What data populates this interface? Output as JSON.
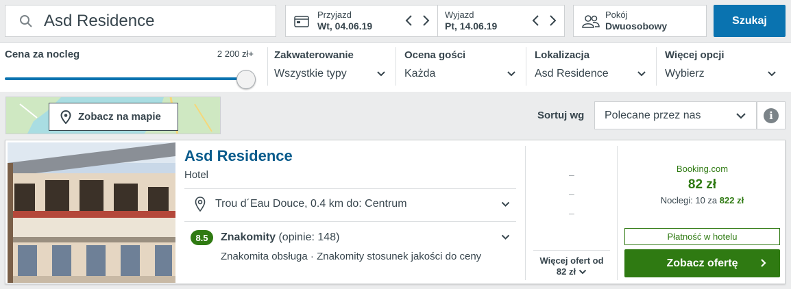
{
  "search": {
    "value": "Asd Residence",
    "icon": "search-icon"
  },
  "dates": {
    "checkin_label": "Przyjazd",
    "checkin_value": "Wt, 04.06.19",
    "checkout_label": "Wyjazd",
    "checkout_value": "Pt, 14.06.19"
  },
  "room": {
    "label": "Pokój",
    "value": "Dwuosobowy"
  },
  "search_button": "Szukaj",
  "filters": {
    "price_label": "Cena za nocleg",
    "price_max": "2 200 zł+",
    "price_slider_fraction": 1.0,
    "accommodation_label": "Zakwaterowanie",
    "accommodation_value": "Wszystkie typy",
    "rating_label": "Ocena gości",
    "rating_value": "Każda",
    "location_label": "Lokalizacja",
    "location_value": "Asd Residence",
    "more_label": "Więcej opcji",
    "more_value": "Wybierz"
  },
  "map": {
    "button_label": "Zobacz na mapie"
  },
  "sort": {
    "label": "Sortuj wg",
    "value": "Polecane przez nas"
  },
  "hotel": {
    "name": "Asd Residence",
    "type": "Hotel",
    "location": "Trou d´Eau Douce, 0.4 km do: Centrum",
    "rating_score": "8.5",
    "rating_word": "Znakomity",
    "rating_count": "(opinie: 148)",
    "rating_description": "Znakomita obsługa · Znakomity stosunek jakości do ceny"
  },
  "offers": {
    "dash": "–",
    "more_line1": "Więcej ofert od",
    "more_line2": "82 zł",
    "provider": "Booking.com",
    "price": "82 zł",
    "nights_prefix": "Noclegi: 10 za",
    "nights_total": "822 zł",
    "pay_at_hotel": "Płatność w hotelu",
    "cta": "Zobacz ofertę"
  },
  "colors": {
    "brand_blue": "#0a73b0",
    "deal_green": "#2f7a12",
    "title_blue": "#0b5c8c"
  }
}
